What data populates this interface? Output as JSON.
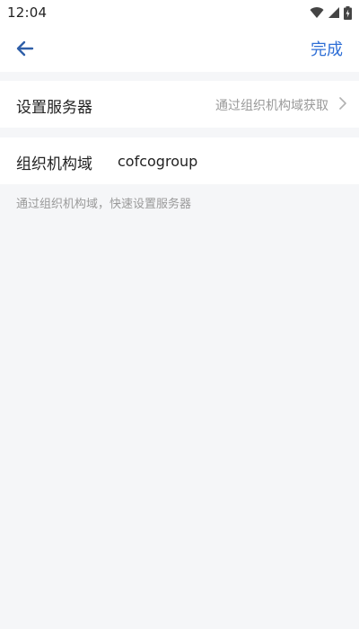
{
  "status_bar": {
    "time": "12:04",
    "icons": [
      "wifi-icon",
      "signal-icon",
      "battery-charging-icon"
    ]
  },
  "app_bar": {
    "back_icon": "arrow-left-icon",
    "done_label": "完成"
  },
  "server_row": {
    "label": "设置服务器",
    "value": "通过组织机构域获取",
    "chevron_icon": "chevron-right-icon"
  },
  "org_row": {
    "label": "组织机构域",
    "value": "cofcogroup"
  },
  "hint": "通过组织机构域，快速设置服务器",
  "colors": {
    "accent": "#2f6fd6",
    "background": "#f5f6f8",
    "surface": "#ffffff",
    "text_primary": "#222222",
    "text_secondary": "#9a9a9a"
  }
}
